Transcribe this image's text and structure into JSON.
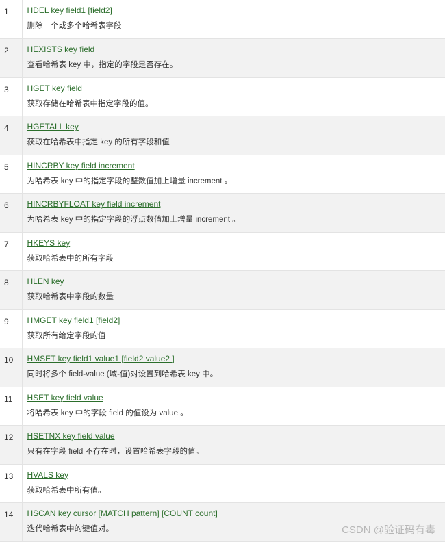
{
  "commands": [
    {
      "num": "1",
      "command": "HDEL key field1 [field2]",
      "desc": "删除一个或多个哈希表字段"
    },
    {
      "num": "2",
      "command": "HEXISTS key field",
      "desc": "查看哈希表 key 中，指定的字段是否存在。"
    },
    {
      "num": "3",
      "command": "HGET key field",
      "desc": "获取存储在哈希表中指定字段的值。"
    },
    {
      "num": "4",
      "command": "HGETALL key",
      "desc": "获取在哈希表中指定 key 的所有字段和值"
    },
    {
      "num": "5",
      "command": "HINCRBY key field increment",
      "desc": "为哈希表 key 中的指定字段的整数值加上增量 increment 。"
    },
    {
      "num": "6",
      "command": "HINCRBYFLOAT key field increment",
      "desc": "为哈希表 key 中的指定字段的浮点数值加上增量 increment 。"
    },
    {
      "num": "7",
      "command": "HKEYS key",
      "desc": "获取哈希表中的所有字段"
    },
    {
      "num": "8",
      "command": "HLEN key",
      "desc": "获取哈希表中字段的数量"
    },
    {
      "num": "9",
      "command": "HMGET key field1 [field2]",
      "desc": "获取所有给定字段的值"
    },
    {
      "num": "10",
      "command": "HMSET key field1 value1 [field2 value2 ]",
      "desc": "同时将多个 field-value (域-值)对设置到哈希表 key 中。"
    },
    {
      "num": "11",
      "command": "HSET key field value",
      "desc": "将哈希表 key 中的字段 field 的值设为 value 。"
    },
    {
      "num": "12",
      "command": "HSETNX key field value",
      "desc": "只有在字段 field 不存在时，设置哈希表字段的值。"
    },
    {
      "num": "13",
      "command": "HVALS key",
      "desc": "获取哈希表中所有值。"
    },
    {
      "num": "14",
      "command": "HSCAN key cursor [MATCH pattern] [COUNT count]",
      "desc": "迭代哈希表中的键值对。"
    }
  ],
  "watermark": "CSDN @验证码有毒"
}
